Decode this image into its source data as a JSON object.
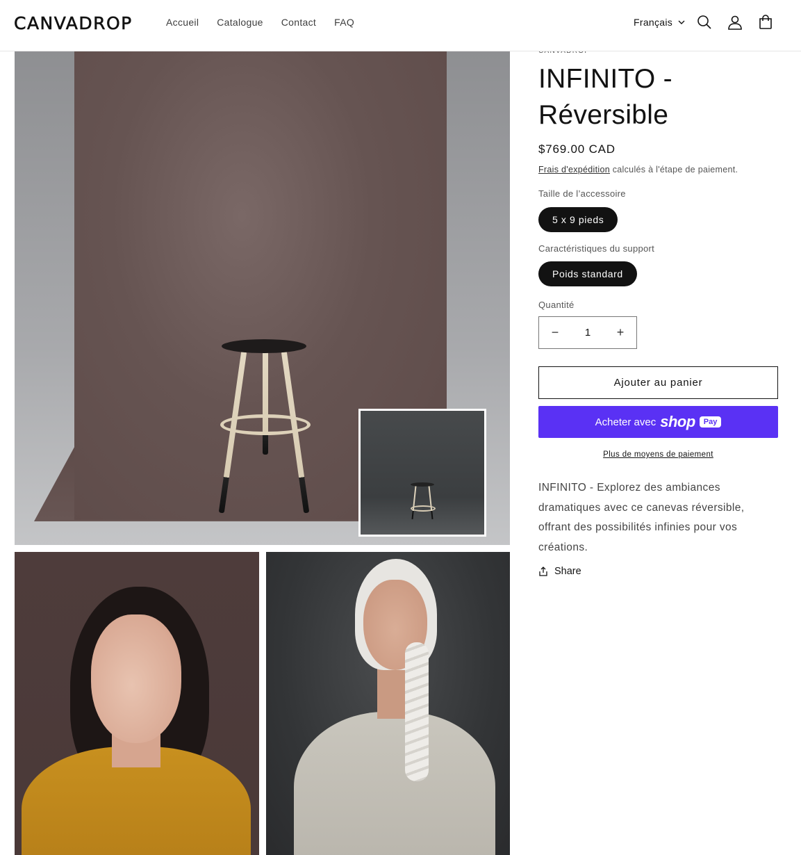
{
  "header": {
    "logo": "CANVADROP",
    "nav": [
      "Accueil",
      "Catalogue",
      "Contact",
      "FAQ"
    ],
    "language": "Français",
    "icons": [
      "search-icon",
      "account-icon",
      "cart-icon"
    ]
  },
  "product": {
    "vendor": "CANVADROP",
    "title": "INFINITO - Réversible",
    "price": "$769.00 CAD",
    "shipping_link": "Frais d'expédition",
    "shipping_rest": " calculés à l'étape de paiement.",
    "size_label": "Taille de l’accessoire",
    "size_value": "5 x 9 pieds",
    "support_label": "Caractéristiques du support",
    "support_value": "Poids standard",
    "quantity_label": "Quantité",
    "quantity": "1",
    "decrease_symbol": "−",
    "increase_symbol": "+",
    "add_to_cart": "Ajouter au panier",
    "buy_with": "Acheter avec",
    "shop_brand": "shop",
    "pay_brand": "Pay",
    "more_payment": "Plus de moyens de paiement",
    "description": "INFINITO - Explorez des ambiances dramatiques avec ce canevas réversible, offrant des possibilités infinies pour vos créations.",
    "share": "Share"
  },
  "colors": {
    "shop_pay": "#5a31f4",
    "pill_bg": "#121212",
    "text": "#121212"
  }
}
